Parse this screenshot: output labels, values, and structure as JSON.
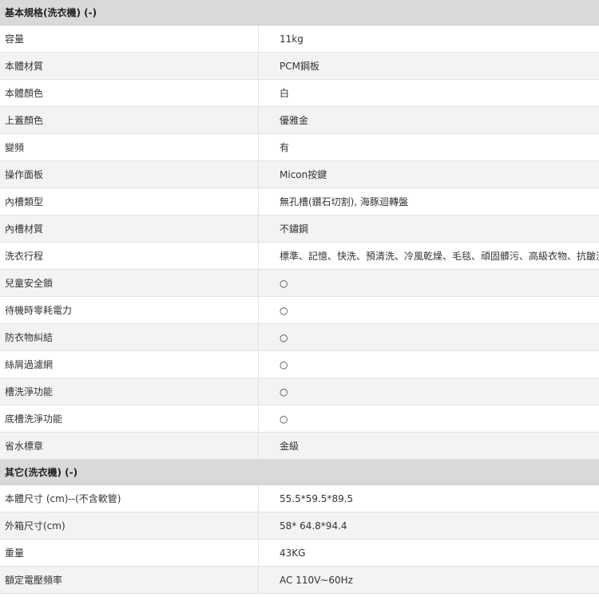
{
  "sections": [
    {
      "title": "基本規格(洗衣機) (-)",
      "rows": [
        {
          "label": "容量",
          "value": "11kg"
        },
        {
          "label": "本體材質",
          "value": "PCM鋼板"
        },
        {
          "label": "本體顏色",
          "value": "白"
        },
        {
          "label": "上蓋顏色",
          "value": "優雅金"
        },
        {
          "label": "變頻",
          "value": "有"
        },
        {
          "label": "操作面板",
          "value": "Micon按鍵"
        },
        {
          "label": "內槽類型",
          "value": "無孔槽(鑽石切割), 海豚迴轉盤"
        },
        {
          "label": "內槽材質",
          "value": "不鏽鋼"
        },
        {
          "label": "洗衣行程",
          "value": "標準、記憶、快洗、預清洗、冷風乾燥、毛毯、頑固髒污、高級衣物、抗皺洗淨"
        },
        {
          "label": "兒童安全鎖",
          "value": "○"
        },
        {
          "label": "待機時零耗電力",
          "value": "○"
        },
        {
          "label": "防衣物糾結",
          "value": "○"
        },
        {
          "label": "絲屑過濾網",
          "value": "○"
        },
        {
          "label": "槽洗淨功能",
          "value": "○"
        },
        {
          "label": "底槽洗淨功能",
          "value": "○"
        },
        {
          "label": "省水標章",
          "value": "金級"
        }
      ]
    },
    {
      "title": "其它(洗衣機) (-)",
      "rows": [
        {
          "label": "本體尺寸 (cm)--(不含軟管)",
          "value": "55.5*59.5*89.5"
        },
        {
          "label": "外箱尺寸(cm)",
          "value": "58* 64.8*94.4"
        },
        {
          "label": "重量",
          "value": "43KG"
        },
        {
          "label": "額定電壓頻率",
          "value": "AC 110V~60Hz"
        }
      ]
    }
  ]
}
